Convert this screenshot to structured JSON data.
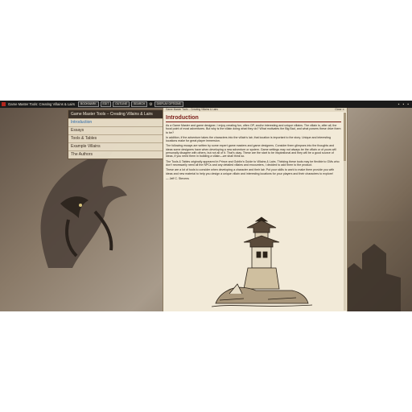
{
  "app": {
    "title": "Game Master Tools: Creating Villains & Lairs",
    "toolbar": {
      "buttons": [
        {
          "label": "BOOKMARK"
        },
        {
          "label": "EDIT"
        },
        {
          "label": "OUTLINE"
        },
        {
          "label": "SEARCH"
        }
      ],
      "extra_label": "DISPLAY OPTIONS"
    },
    "colors": {
      "topbar": "#1b1b1b",
      "accent": "#b3261e",
      "heading": "#7c1f1a",
      "active_link": "#2a67a8"
    }
  },
  "toc": {
    "header": "Game Master Tools – Creating Villains & Lairs",
    "items": [
      {
        "label": "Introduction",
        "active": true
      },
      {
        "label": "Essays",
        "active": false
      },
      {
        "label": "Tools & Tables",
        "active": false
      },
      {
        "label": "Example Villains",
        "active": false
      },
      {
        "label": "The Authors",
        "active": false
      }
    ]
  },
  "document": {
    "window_title": "Game Master Tools – Creating Villains & Lairs",
    "close_label": "Close ✕",
    "heading": "Introduction",
    "paragraphs": [
      "As a Game Master and game designer, I enjoy creating fun, often OP, and/or interesting and unique villains. The villain is, after all, the focal point of most adventures. But why is the villain doing what they do? What motivates the Big Bad, and what powers these drive them to be?",
      "In addition, if the adventure takes the characters into the villain’s lair, that location is important to the story. Unique and interesting locations make for great player immersion.",
      "The following essays are written by some expert game masters and game designers. Consider them glimpses into the thoughts and ideas some designers have when developing a new adventure or system. Game settings may not always be the villain or of yours will personally disagree with others, but not all of it. That’s okay. These are the start to be inspirational and they will be a good source of ideas, if you need them in building a villain—we shall think so.",
      "The Tools & Tables originally appeared in Prince and Goblin’s Guide to Villains & Lairs. Thinking these tools may be flexible to GMs who don’t necessarily need all the NPCs and any detailed villains and encounters, I decided to add them to the product.",
      "These are a lot of tools to consider when developing a character and their lair. Put your skills to work to make them provide you with ideas and new material to help you design a unique villain and interesting locations for your players and their characters to explore!"
    ],
    "signature": "— Jeff C. Stevens"
  }
}
